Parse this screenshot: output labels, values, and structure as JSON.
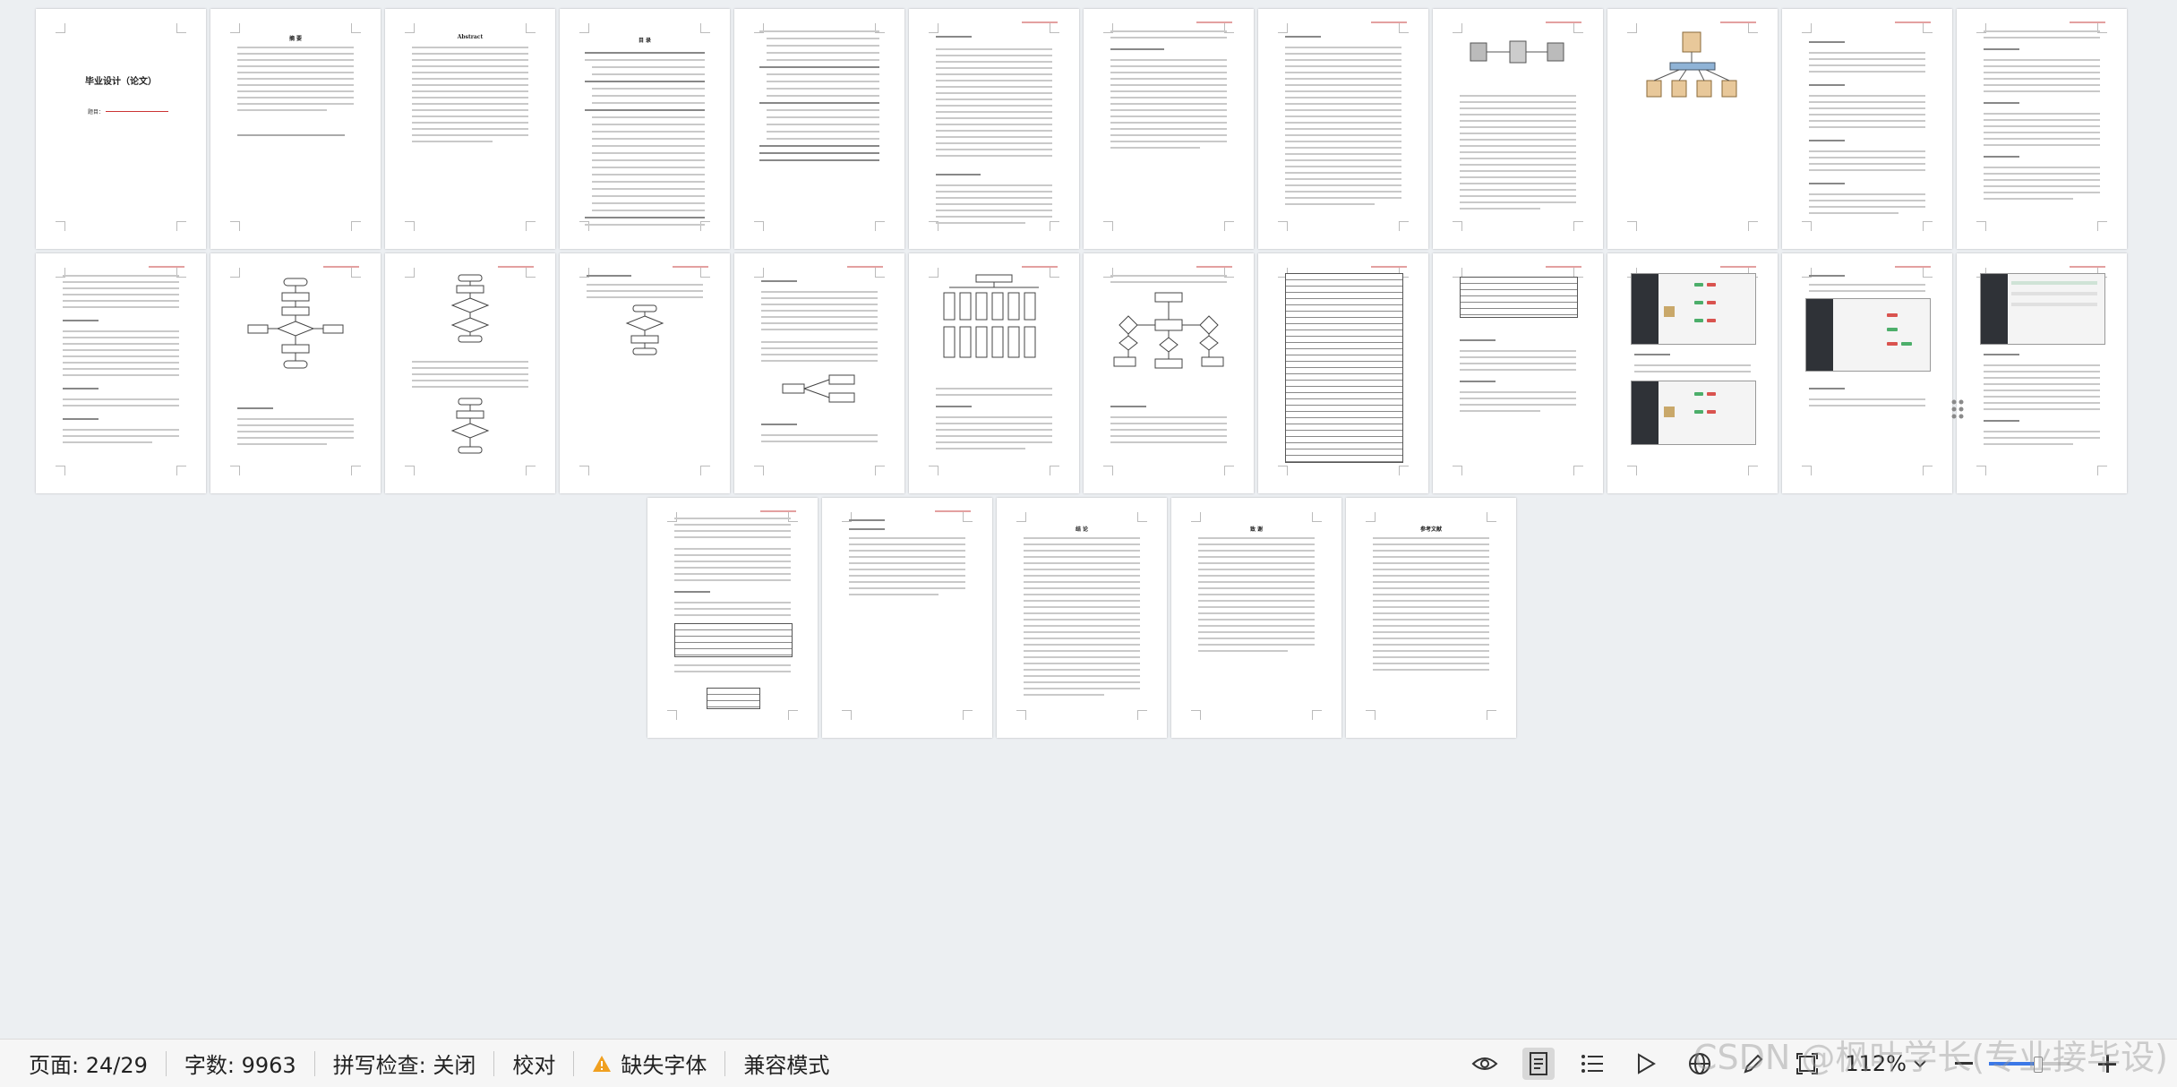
{
  "document": {
    "cover_title": "毕业设计（论文）",
    "cover_subtitle": "题目：",
    "abstract_cn_title": "摘 要",
    "abstract_en_title": "Abstract",
    "toc_title": "目 录",
    "conclusion_title": "结 论",
    "thanks_title": "致 谢",
    "references_title": "参考文献"
  },
  "statusbar": {
    "page_label": "页面: 24/29",
    "word_count_label": "字数: 9963",
    "spellcheck_label": "拼写检查: 关闭",
    "proofread_label": "校对",
    "missing_font_label": "缺失字体",
    "compat_label": "兼容模式",
    "zoom_label": "112%",
    "colors": {
      "warning": "#f0a020",
      "text": "#222222"
    }
  },
  "watermark": {
    "text": "CSDN @枫叶学长(专业接毕设)"
  },
  "icons": [
    "eye-icon",
    "page-view-icon",
    "outline-icon",
    "play-icon",
    "web-layout-icon",
    "pen-icon",
    "fullscreen-icon",
    "zoom-out-icon",
    "zoom-in-icon",
    "dropdown-icon",
    "drag-handle-icon"
  ]
}
